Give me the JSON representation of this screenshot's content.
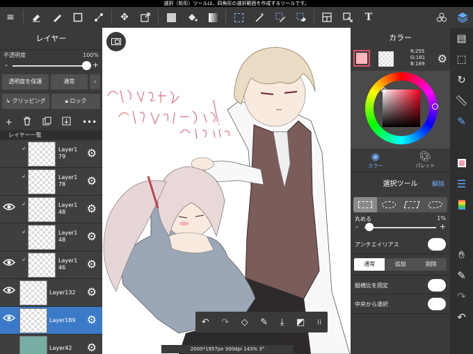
{
  "status_bar": {
    "message": "選択（矩形）ツールは、四角形の選択範囲を作成するツールです。"
  },
  "toolbar": {
    "items": [
      {
        "name": "menu-icon",
        "glyph": "≡"
      },
      {
        "name": "eraser-icon",
        "glyph": "◈"
      },
      {
        "name": "brush-icon",
        "glyph": "✎"
      },
      {
        "name": "square-icon",
        "glyph": "□"
      },
      {
        "name": "dot-tool-icon",
        "glyph": "⋰"
      },
      {
        "name": "move-icon",
        "glyph": "✥"
      },
      {
        "name": "transform-icon",
        "glyph": "⤢"
      },
      {
        "name": "fill-color-icon",
        "glyph": ""
      },
      {
        "name": "bucket-icon",
        "glyph": "⛾"
      },
      {
        "name": "gradient-icon",
        "glyph": ""
      },
      {
        "name": "select-rect-icon",
        "glyph": ""
      },
      {
        "name": "magic-wand-icon",
        "glyph": "⚚"
      },
      {
        "name": "select-pen-icon",
        "glyph": "✐"
      },
      {
        "name": "select-eraser-icon",
        "glyph": "◇"
      },
      {
        "name": "frame-divider-icon",
        "glyph": "⊟"
      },
      {
        "name": "operation-icon",
        "glyph": "⇱"
      },
      {
        "name": "text-icon",
        "glyph": "T"
      },
      {
        "name": "materials-icon",
        "glyph": "❖"
      },
      {
        "name": "layers-icon",
        "glyph": "◈"
      }
    ]
  },
  "layer_panel": {
    "title": "レイヤー",
    "opacity_label": "不透明度",
    "opacity_value": "100%",
    "opacity_level": 1.0,
    "protect_alpha": "透明度を保護",
    "blend_mode": "通常",
    "clipping": "クリッピング",
    "lock": "ロック",
    "list_title": "レイヤー一覧",
    "layers": [
      {
        "name": "Layer1\n79",
        "visible": false,
        "clipped": true,
        "selected": false
      },
      {
        "name": "Layer1\n78",
        "visible": false,
        "clipped": true,
        "selected": false
      },
      {
        "name": "Layer1\n48",
        "visible": true,
        "clipped": true,
        "selected": false
      },
      {
        "name": "Layer1\n48",
        "visible": false,
        "clipped": true,
        "selected": false
      },
      {
        "name": "Layer1\n46",
        "visible": true,
        "clipped": true,
        "selected": false
      },
      {
        "name": "Layer132",
        "visible": true,
        "clipped": false,
        "selected": false
      },
      {
        "name": "Layer189",
        "visible": true,
        "clipped": false,
        "selected": true
      },
      {
        "name": "Layer42",
        "visible": false,
        "clipped": false,
        "selected": false,
        "fill": "#76aea4"
      }
    ]
  },
  "canvas": {
    "info": "2000*1957px 300dpi 143% 3°",
    "handwriting": "別に何も期待なんてしてないし…！"
  },
  "floating_bar": [
    "undo-icon",
    "redo-icon",
    "lasso-fill-icon",
    "eyedropper-icon",
    "save-icon",
    "transform-canvas-icon",
    "grid-menu-icon"
  ],
  "color_panel": {
    "title": "カラー",
    "main_color": "#ffb5bd",
    "r": "R:255",
    "g": "G:181",
    "b": "B:189",
    "tab_color": "カラー",
    "tab_palette": "パレット"
  },
  "selection_panel": {
    "title": "選択ツール",
    "cancel": "解除",
    "round_label": "丸める",
    "round_value": "1%",
    "round_level": 0.01,
    "antialias": "アンチエイリアス",
    "modes": [
      "通常",
      "追加",
      "削除"
    ],
    "active_mode": 0,
    "fix_aspect": "縦横比を固定",
    "from_center": "中央から選択"
  },
  "right_strip": [
    "layers-sheet-icon",
    "selection-icon",
    "rotate-icon",
    "ruler-icon",
    "pen-settings-icon",
    "color-icon",
    "brush-list-icon",
    "palette-icon",
    "hand-icon",
    "dropper-icon",
    "redo-icon",
    "undo-icon"
  ]
}
